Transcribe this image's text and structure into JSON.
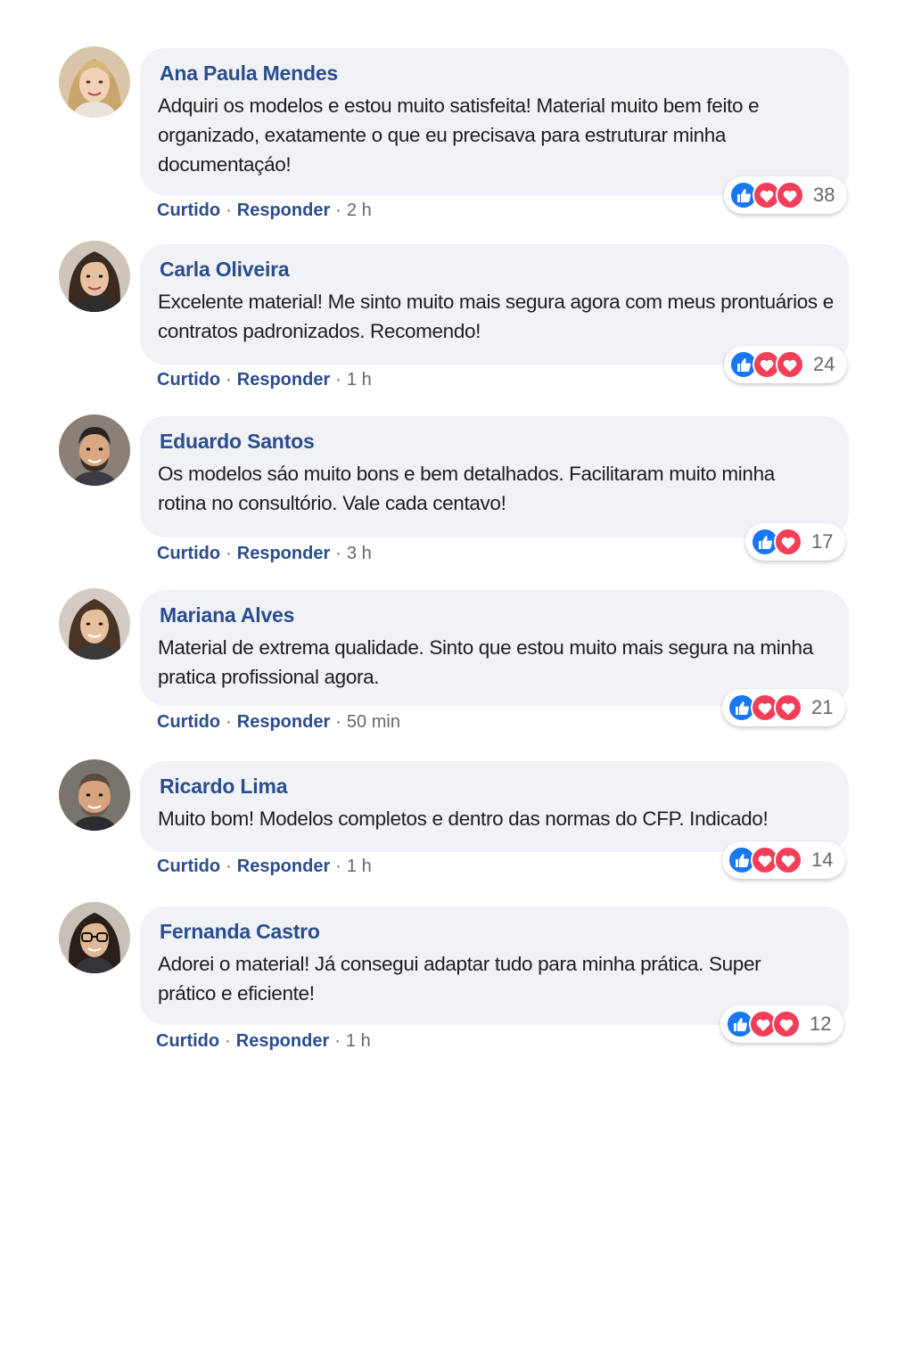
{
  "colors": {
    "bubble_bg": "#f0f2f5",
    "author": "#2a4d8f",
    "action_link": "#2a4d8f",
    "meta": "#65676b",
    "like_blue": "#1877f2",
    "love_red": "#f33e58"
  },
  "reaction_icons": [
    "like-icon",
    "love-icon"
  ],
  "comments": [
    {
      "author": "Ana Paula Mendes",
      "text": "Adquiri os modelos e estou muito satisfeita!  Material muito bem feito e organizado, exatamente o que eu precisava para estruturar minha documentaçáo!",
      "like_label": "Curtido",
      "reply_label": "Responder",
      "time": "2 h",
      "reaction_count": "38",
      "reaction_types": [
        "like",
        "love",
        "love"
      ]
    },
    {
      "author": "Carla Oliveira",
      "text": "Excelente material! Me sinto muito mais segura agora com meus prontuários e contratos padronizados. Recomendo!",
      "like_label": "Curtido",
      "reply_label": "Responder",
      "time": "1 h",
      "reaction_count": "24",
      "reaction_types": [
        "like",
        "love",
        "love"
      ]
    },
    {
      "author": "Eduardo Santos",
      "text": "Os modelos sáo muito bons e bem detalhados. Facilitaram muito minha rotina no consultório. Vale cada centavo!",
      "like_label": "Curtido",
      "reply_label": "Responder",
      "time": "3 h",
      "reaction_count": "17",
      "reaction_types": [
        "like",
        "love"
      ]
    },
    {
      "author": "Mariana Alves",
      "text": "Material de extrema qualidade. Sinto que estou muito mais segura na minha pratica profissional agora.",
      "like_label": "Curtido",
      "reply_label": "Responder",
      "time": "50 min",
      "reaction_count": "21",
      "reaction_types": [
        "like",
        "love",
        "love"
      ]
    },
    {
      "author": "Ricardo Lima",
      "text": "Muito bom! Modelos completos e dentro das normas do CFP. Indicado!",
      "like_label": "Curtido",
      "reply_label": "Responder",
      "time": "1 h",
      "reaction_count": "14",
      "reaction_types": [
        "like",
        "love",
        "love"
      ]
    },
    {
      "author": "Fernanda Castro",
      "text": "Adorei o material! Já consegui adaptar tudo para minha prática. Super prático e eficiente!",
      "like_label": "Curtido",
      "reply_label": "Responder",
      "time": "1 h",
      "reaction_count": "12",
      "reaction_types": [
        "like",
        "love",
        "love"
      ]
    }
  ]
}
